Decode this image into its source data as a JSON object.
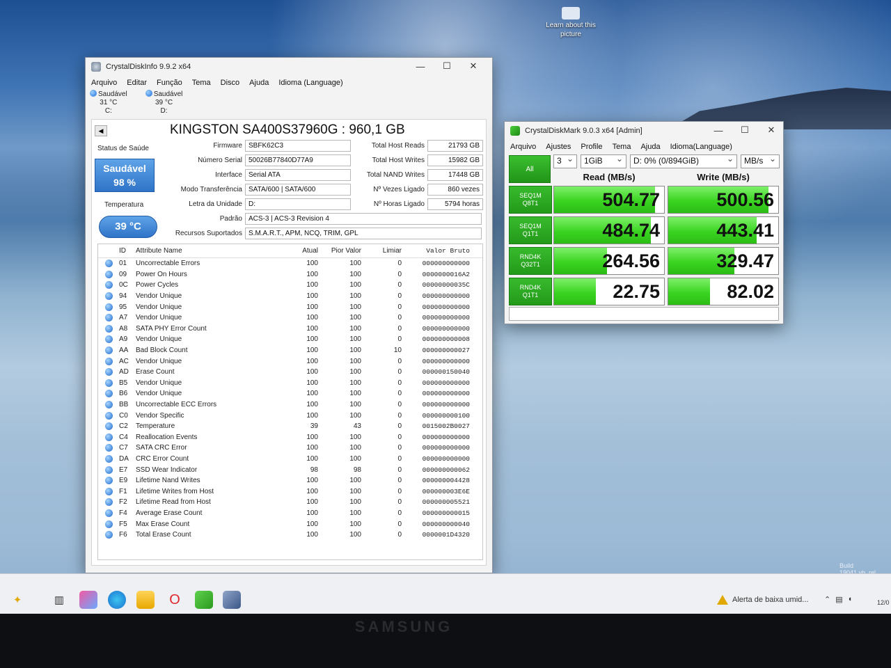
{
  "desktop": {
    "icon_label": "Learn about this picture",
    "build_text": "Build 19041.vb_rel"
  },
  "taskbar": {
    "alert_text": "Alerta de baixa umid...",
    "date_text": "12/0"
  },
  "monitor": {
    "brand": "SAMSUNG"
  },
  "cdi": {
    "title": "CrystalDiskInfo 9.9.2 x64",
    "menu": [
      "Arquivo",
      "Editar",
      "Função",
      "Tema",
      "Disco",
      "Ajuda",
      "Idioma (Language)"
    ],
    "drives": [
      {
        "status": "Saudável",
        "temp": "31 °C",
        "letter": "C:"
      },
      {
        "status": "Saudável",
        "temp": "39 °C",
        "letter": "D:"
      }
    ],
    "model": "KINGSTON SA400S37960G : 960,1 GB",
    "health_label": "Status de Saúde",
    "health_status": "Saudável",
    "health_pct": "98 %",
    "temp_label": "Temperatura",
    "temp_value": "39 °C",
    "fields": {
      "firmware_l": "Firmware",
      "firmware": "SBFK62C3",
      "serial_l": "Número Serial",
      "serial": "50026B77840D77A9",
      "interface_l": "Interface",
      "interface": "Serial ATA",
      "transfer_l": "Modo Transferência",
      "transfer": "SATA/600 | SATA/600",
      "letter_l": "Letra da Unidade",
      "letter": "D:",
      "standard_l": "Padrão",
      "standard": "ACS-3 | ACS-3 Revision 4",
      "features_l": "Recursos Suportados",
      "features": "S.M.A.R.T., APM, NCQ, TRIM, GPL",
      "reads_l": "Total Host Reads",
      "reads": "21793 GB",
      "writes_l": "Total Host Writes",
      "writes": "15982 GB",
      "nand_l": "Total NAND Writes",
      "nand": "17448 GB",
      "powercount_l": "Nº Vezes Ligado",
      "powercount": "860 vezes",
      "powerhours_l": "Nº Horas Ligado",
      "powerhours": "5794 horas"
    },
    "smart_headers": [
      "ID",
      "Attribute Name",
      "Atual",
      "Pior Valor",
      "Limiar",
      "Valor Bruto"
    ],
    "smart": [
      [
        "01",
        "Uncorrectable Errors",
        "100",
        "100",
        "0",
        "000000000000"
      ],
      [
        "09",
        "Power On Hours",
        "100",
        "100",
        "0",
        "0000000016A2"
      ],
      [
        "0C",
        "Power Cycles",
        "100",
        "100",
        "0",
        "00000000035C"
      ],
      [
        "94",
        "Vendor Unique",
        "100",
        "100",
        "0",
        "000000000000"
      ],
      [
        "95",
        "Vendor Unique",
        "100",
        "100",
        "0",
        "000000000000"
      ],
      [
        "A7",
        "Vendor Unique",
        "100",
        "100",
        "0",
        "000000000000"
      ],
      [
        "A8",
        "SATA PHY Error Count",
        "100",
        "100",
        "0",
        "000000000000"
      ],
      [
        "A9",
        "Vendor Unique",
        "100",
        "100",
        "0",
        "000000000008"
      ],
      [
        "AA",
        "Bad Block Count",
        "100",
        "100",
        "10",
        "000000000027"
      ],
      [
        "AC",
        "Vendor Unique",
        "100",
        "100",
        "0",
        "000000000000"
      ],
      [
        "AD",
        "Erase Count",
        "100",
        "100",
        "0",
        "000000150040"
      ],
      [
        "B5",
        "Vendor Unique",
        "100",
        "100",
        "0",
        "000000000000"
      ],
      [
        "B6",
        "Vendor Unique",
        "100",
        "100",
        "0",
        "000000000000"
      ],
      [
        "BB",
        "Uncorrectable ECC Errors",
        "100",
        "100",
        "0",
        "000000000000"
      ],
      [
        "C0",
        "Vendor Specific",
        "100",
        "100",
        "0",
        "000000000100"
      ],
      [
        "C2",
        "Temperature",
        "39",
        "43",
        "0",
        "0015002B0027"
      ],
      [
        "C4",
        "Reallocation Events",
        "100",
        "100",
        "0",
        "000000000000"
      ],
      [
        "C7",
        "SATA CRC Error",
        "100",
        "100",
        "0",
        "000000000000"
      ],
      [
        "DA",
        "CRC Error Count",
        "100",
        "100",
        "0",
        "000000000000"
      ],
      [
        "E7",
        "SSD Wear Indicator",
        "98",
        "98",
        "0",
        "000000000062"
      ],
      [
        "E9",
        "Lifetime Nand Writes",
        "100",
        "100",
        "0",
        "000000004428"
      ],
      [
        "F1",
        "Lifetime Writes from Host",
        "100",
        "100",
        "0",
        "000000003E6E"
      ],
      [
        "F2",
        "Lifetime Read from Host",
        "100",
        "100",
        "0",
        "000000005521"
      ],
      [
        "F4",
        "Average Erase Count",
        "100",
        "100",
        "0",
        "000000000015"
      ],
      [
        "F5",
        "Max Erase Count",
        "100",
        "100",
        "0",
        "000000000040"
      ],
      [
        "F6",
        "Total Erase Count",
        "100",
        "100",
        "0",
        "0000001D4320"
      ]
    ]
  },
  "cdm": {
    "title": "CrystalDiskMark 9.0.3 x64 [Admin]",
    "menu": [
      "Arquivo",
      "Ajustes",
      "Profile",
      "Tema",
      "Ajuda",
      "Idioma(Language)"
    ],
    "all_label": "All",
    "count": "3",
    "size": "1GiB",
    "drive": "D: 0% (0/894GiB)",
    "unit": "MB/s",
    "read_header": "Read (MB/s)",
    "write_header": "Write (MB/s)",
    "max_scale": 550,
    "tests": [
      {
        "l1": "SEQ1M",
        "l2": "Q8T1",
        "read": "504.77",
        "write": "500.56"
      },
      {
        "l1": "SEQ1M",
        "l2": "Q1T1",
        "read": "484.74",
        "write": "443.41"
      },
      {
        "l1": "RND4K",
        "l2": "Q32T1",
        "read": "264.56",
        "write": "329.47"
      },
      {
        "l1": "RND4K",
        "l2": "Q1T1",
        "read": "22.75",
        "write": "82.02"
      }
    ]
  }
}
